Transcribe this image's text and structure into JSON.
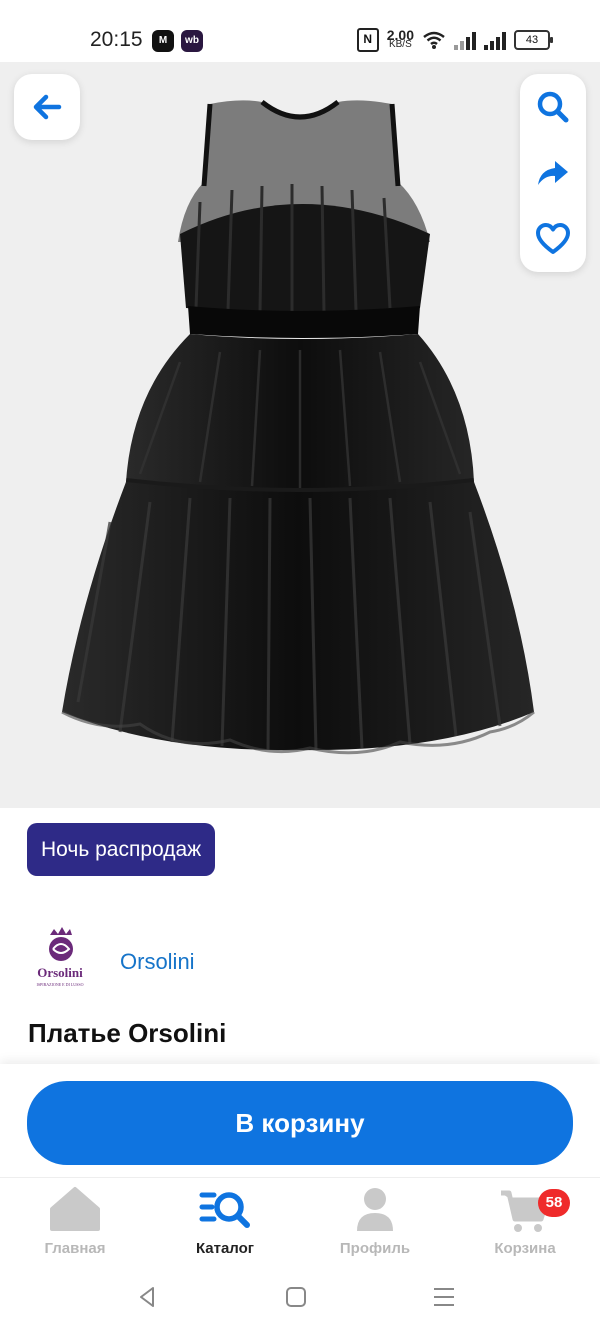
{
  "status": {
    "time": "20:15",
    "app1": "M",
    "app2": "wb",
    "nfc": "N",
    "speed_value": "2.00",
    "speed_unit": "KB/S",
    "battery": "43",
    "battery_level": 0.43
  },
  "gallery": {
    "image": "black-tulle-dress",
    "image_count": 5,
    "active_index": 1
  },
  "actions": {
    "back": "back-arrow-icon",
    "search": "search-icon",
    "share": "share-icon",
    "favorite": "heart-icon"
  },
  "promo": {
    "label": "Ночь распродаж"
  },
  "brand": {
    "name": "Orsolini",
    "logo_text": "Orsolini",
    "logo_subtext": "ISPIRAZIONE E DI LUSSO"
  },
  "product": {
    "title": "Платье Orsolini"
  },
  "cart_button": {
    "label": "В корзину"
  },
  "tabs": [
    {
      "label": "Главная",
      "icon": "home-icon",
      "active": false
    },
    {
      "label": "Каталог",
      "icon": "catalog-search-icon",
      "active": true
    },
    {
      "label": "Профиль",
      "icon": "profile-icon",
      "active": false
    },
    {
      "label": "Корзина",
      "icon": "cart-icon",
      "active": false,
      "badge": "58"
    }
  ],
  "colors": {
    "accent": "#0f74e0",
    "promo": "#2e2a87",
    "badge": "#ef2b2b",
    "brand_link": "#1674c9",
    "logo": "#6b2a7a"
  }
}
